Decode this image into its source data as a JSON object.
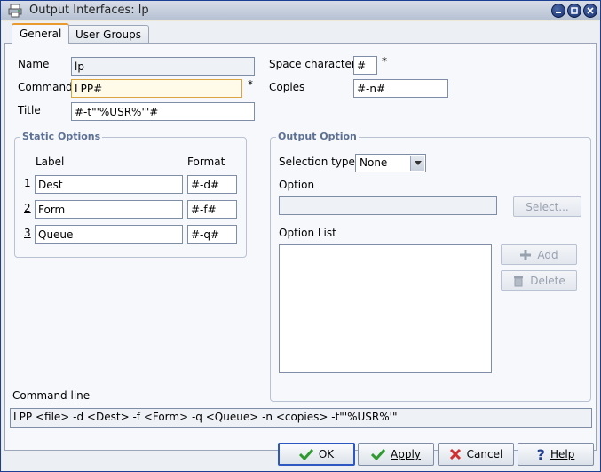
{
  "window": {
    "title": "Output Interfaces: lp"
  },
  "tabs": [
    {
      "label": "General"
    },
    {
      "label": "User Groups"
    }
  ],
  "general": {
    "name_label": "Name",
    "name_value": "lp",
    "command_label": "Command",
    "command_value": "LPP#",
    "command_required": "*",
    "title_label": "Title",
    "title_value": "#-t\"'%USR%'\"#",
    "space_label": "Space character",
    "space_value": "#",
    "space_required": "*",
    "copies_label": "Copies",
    "copies_value": "#-n#"
  },
  "static_options": {
    "legend": "Static Options",
    "label_header": "Label",
    "format_header": "Format",
    "rows": [
      {
        "num": "1",
        "label": "Dest",
        "format": "#-d#"
      },
      {
        "num": "2",
        "label": "Form",
        "format": "#-f#"
      },
      {
        "num": "3",
        "label": "Queue",
        "format": "#-q#"
      }
    ]
  },
  "output_option": {
    "legend": "Output Option",
    "selection_type_label": "Selection type",
    "selection_type_value": "None",
    "option_label": "Option",
    "option_value": "",
    "select_button": "Select...",
    "option_list_label": "Option List",
    "add_button": "Add",
    "delete_button": "Delete"
  },
  "command_line": {
    "label": "Command line",
    "value": "LPP <file> -d <Dest> -f <Form> -q <Queue> -n <copies> -t\"'%USR%'\""
  },
  "footer": {
    "ok": "OK",
    "apply": "Apply",
    "cancel": "Cancel",
    "help": "Help"
  },
  "colors": {
    "accent_tab": "#e99a2d",
    "legend_text": "#5c7093",
    "window_frame": "#1c3f94"
  }
}
